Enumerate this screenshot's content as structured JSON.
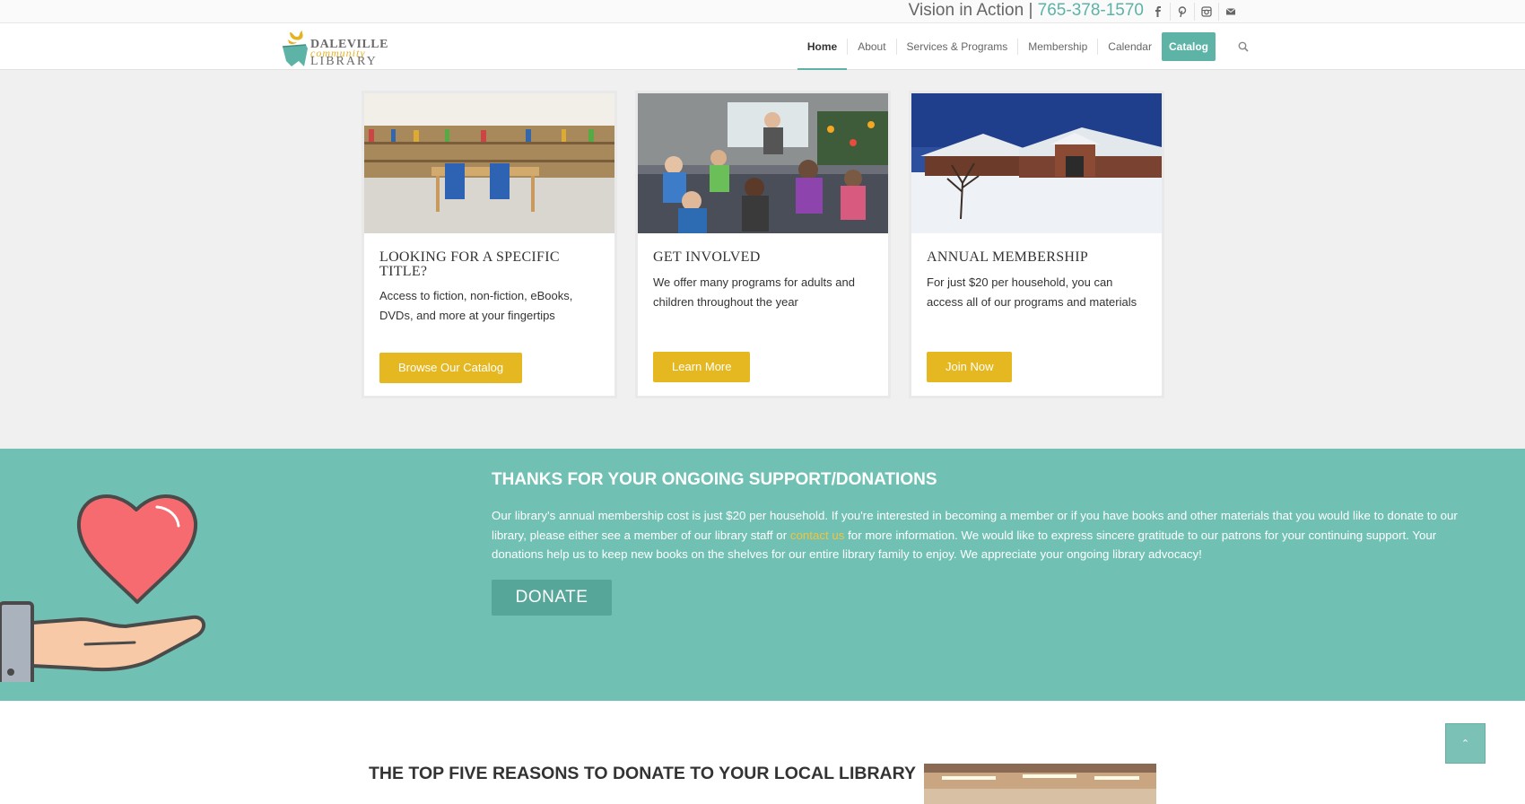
{
  "topbar": {
    "tagline": "Vision in Action |",
    "phone": "765-378-1570",
    "social_icons": [
      "facebook-icon",
      "pinterest-icon",
      "instagram-icon",
      "mail-icon"
    ]
  },
  "logo": {
    "line1": "DALEVILLE",
    "line2": "community",
    "line3": "LIBRARY"
  },
  "nav": {
    "items": [
      "Home",
      "About",
      "Services & Programs",
      "Membership",
      "Calendar"
    ],
    "catalog": "Catalog",
    "active": "Home"
  },
  "cards": [
    {
      "title": "LOOKING FOR A SPECIFIC TITLE?",
      "text": "Access to fiction, non-fiction, eBooks, DVDs, and more at your fingertips",
      "button": "Browse Our Catalog"
    },
    {
      "title": "GET INVOLVED",
      "text": "We offer many programs for adults and children throughout the year",
      "button": "Learn More"
    },
    {
      "title": "ANNUAL MEMBERSHIP",
      "text": "For just $20 per household, you can access all of our programs and materials",
      "button": "Join Now"
    }
  ],
  "donate_band": {
    "heading": "THANKS FOR YOUR ONGOING SUPPORT/DONATIONS",
    "text_before": "Our library's annual membership cost is just $20 per household. If you're interested in becoming a member or if you have books and other materials that you would like to donate to our library, please either see a member of our library staff or ",
    "link": "contact us",
    "text_after": " for more information. We would like to express sincere gratitude to our patrons for your continuing support. Your donations help us to keep new books on the shelves for our entire library family to enjoy. We appreciate your ongoing library advocacy!",
    "button": "DONATE"
  },
  "bottom": {
    "heading": "THE TOP FIVE REASONS TO DONATE TO YOUR LOCAL LIBRARY"
  },
  "colors": {
    "teal": "#70c1b3",
    "accent_teal": "#5cb3a6",
    "yellow": "#e5b721",
    "link_yellow": "#f3c33e"
  }
}
